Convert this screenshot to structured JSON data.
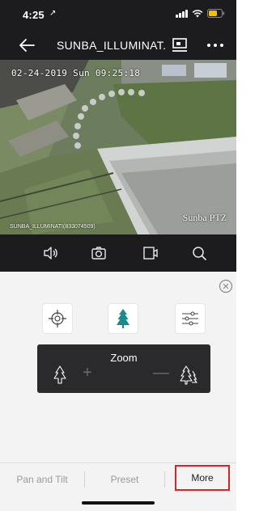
{
  "status_bar": {
    "time": "4:25",
    "location_arrow": "↗"
  },
  "header": {
    "title": "SUNBA_ILLUMINAT...",
    "back_icon": "back-arrow-icon",
    "screen_icon": "screen-record-icon",
    "more_icon": "more-icon"
  },
  "video": {
    "timestamp": "02-24-2019 Sun 09:25:18",
    "brand": "Sunba PTZ",
    "caption": "SUNBA_ILLUMINATI(833074509)"
  },
  "toolbar": {
    "items": [
      "speaker-icon",
      "snapshot-icon",
      "record-icon",
      "zoom-search-icon"
    ]
  },
  "ptz_panel": {
    "close_icon": "close-icon",
    "functions": [
      "crosshair-icon",
      "tree-icon",
      "sliders-icon"
    ],
    "zoom": {
      "label": "Zoom",
      "zoom_out_icon": "zoom-out-tree-icon",
      "zoom_in_icon": "zoom-in-trees-icon",
      "plus": "+",
      "minus": "—"
    }
  },
  "tabs": {
    "items": [
      "Pan and Tilt",
      "Preset",
      "More"
    ],
    "selected": "More",
    "highlight_color": "#d6252a"
  },
  "colors": {
    "header_bg": "#1c1c1e",
    "panel_bg": "#f3f3f3",
    "accent_teal": "#1b8a8a"
  }
}
